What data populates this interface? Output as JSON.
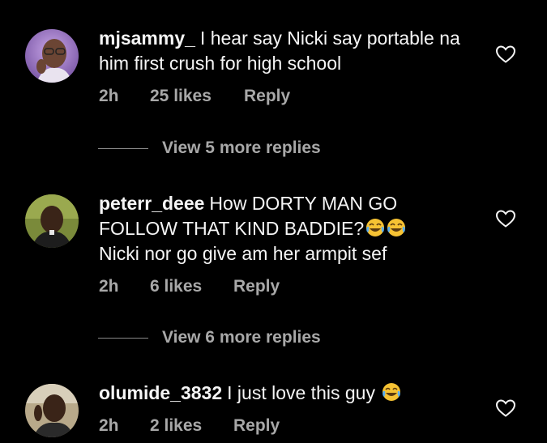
{
  "comments": [
    {
      "username": "mjsammy_",
      "text": "I hear say Nicki say portable na him first crush for high school",
      "time": "2h",
      "likes": "25 likes",
      "reply_label": "Reply",
      "view_replies": "View 5 more replies"
    },
    {
      "username": "peterr_deee",
      "text": "How DORTY MAN GO FOLLOW THAT KIND BADDIE?",
      "text2": "Nicki nor go give am her armpit sef",
      "emojis": [
        "face-with-tears-of-joy",
        "face-with-tears-of-joy"
      ],
      "time": "2h",
      "likes": "6 likes",
      "reply_label": "Reply",
      "view_replies": "View 6 more replies"
    },
    {
      "username": "olumide_3832",
      "text": "I just love this guy",
      "emojis": [
        "face-with-tears-of-joy"
      ],
      "time": "2h",
      "likes": "2 likes",
      "reply_label": "Reply"
    }
  ],
  "colors": {
    "background": "#000000",
    "text": "#f5f5f5",
    "muted": "#a8a8a8"
  }
}
